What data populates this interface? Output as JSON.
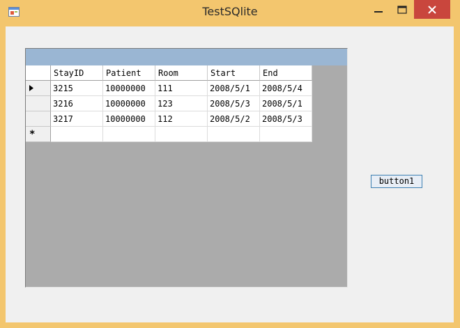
{
  "window": {
    "title": "TestSQlite",
    "controls": {
      "minimize": "minimize",
      "maximize": "maximize",
      "close": "close"
    }
  },
  "grid": {
    "columns": [
      "StayID",
      "Patient",
      "Room",
      "Start",
      "End"
    ],
    "rows": [
      [
        "3215",
        "10000000",
        "111",
        "2008/5/1",
        "2008/5/4"
      ],
      [
        "3216",
        "10000000",
        "123",
        "2008/5/3",
        "2008/5/1"
      ],
      [
        "3217",
        "10000000",
        "112",
        "2008/5/2",
        "2008/5/3"
      ]
    ],
    "new_row_marker": "*",
    "current_row_marker": "▶"
  },
  "button1": {
    "label": "button1"
  },
  "colors": {
    "title_bar": "#f3c66e",
    "close_button": "#c9463d",
    "grid_caption": "#9ab6d3",
    "grid_background": "#ababab"
  }
}
